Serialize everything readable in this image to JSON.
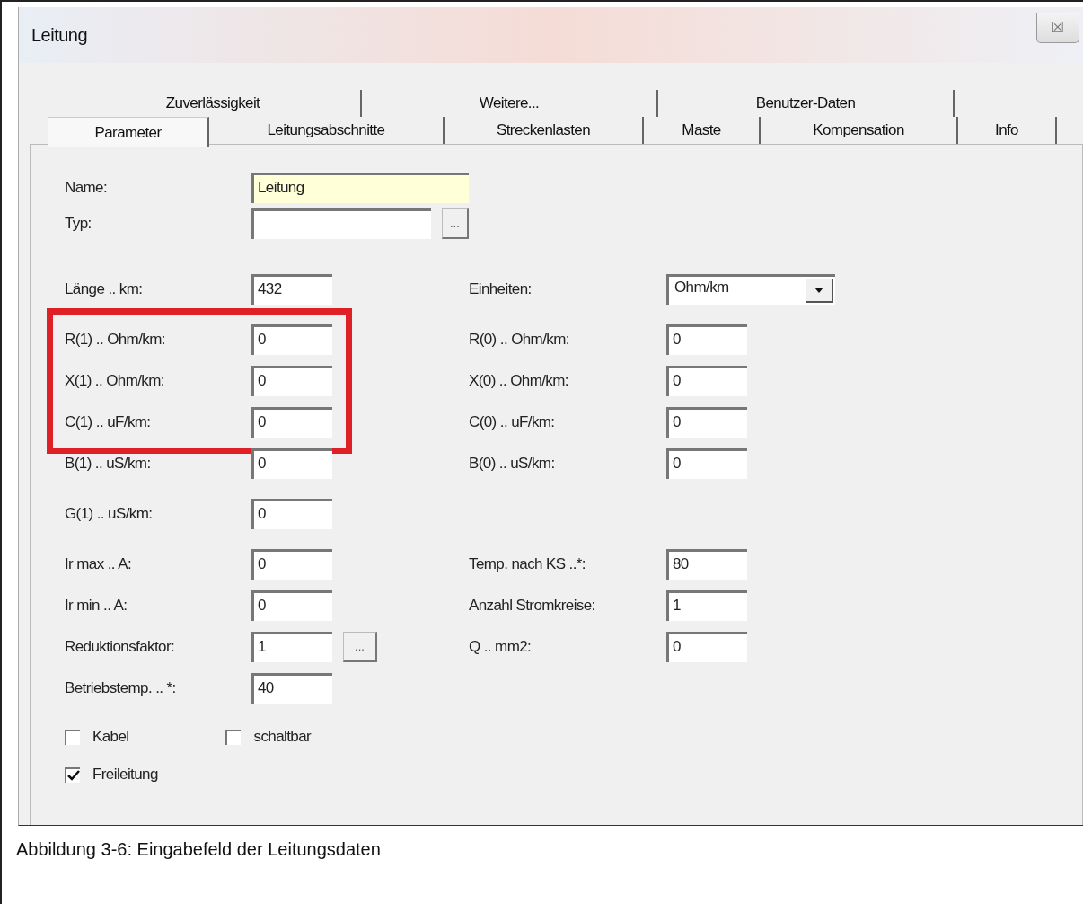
{
  "window": {
    "title": "Leitung",
    "close": "☒"
  },
  "tabs_back_row": [
    {
      "label": "Zuverlässigkeit",
      "selected": false
    },
    {
      "label": "Weitere...",
      "selected": false
    },
    {
      "label": "Benutzer-Daten",
      "selected": false
    }
  ],
  "tabs_front_row": [
    {
      "label": "Parameter",
      "selected": true
    },
    {
      "label": "Leitungsabschnitte",
      "selected": false
    },
    {
      "label": "Streckenlasten",
      "selected": false
    },
    {
      "label": "Maste",
      "selected": false
    },
    {
      "label": "Kompensation",
      "selected": false
    },
    {
      "label": "Info",
      "selected": false
    }
  ],
  "sections": [
    [
      {
        "left": {
          "label": "Name:",
          "value": "Leitung",
          "kind": "wide",
          "focused": true
        }
      },
      {
        "left": {
          "label": "Typ:",
          "kind": "wide",
          "focused": false,
          "browse": "..."
        }
      }
    ],
    [
      {
        "left": {
          "label": "Länge .. km:",
          "value": "432"
        },
        "right": {
          "label": "Einheiten:",
          "value": "Ohm/km",
          "kind": "dropdown"
        }
      }
    ],
    [
      {
        "highlighted": true,
        "left": {
          "label": "R(1) .. Ohm/km:",
          "value": "0"
        },
        "right": {
          "label": "R(0) .. Ohm/km:",
          "value": "0"
        }
      },
      {
        "highlighted": true,
        "left": {
          "label": "X(1) .. Ohm/km:",
          "value": "0"
        },
        "right": {
          "label": "X(0) .. Ohm/km:",
          "value": "0"
        }
      },
      {
        "highlighted": true,
        "left": {
          "label": "C(1) .. uF/km:",
          "value": "0"
        },
        "right": {
          "label": "C(0) .. uF/km:",
          "value": "0"
        }
      },
      {
        "left": {
          "label": "B(1) .. uS/km:",
          "value": "0"
        },
        "right": {
          "label": "B(0) .. uS/km:",
          "value": "0"
        }
      }
    ],
    [
      {
        "left": {
          "label": "G(1) .. uS/km:",
          "value": "0"
        }
      }
    ],
    [
      {
        "left": {
          "label": "Ir max .. A:",
          "value": "0"
        },
        "right": {
          "label": "Temp. nach KS ..*:",
          "value": "80"
        }
      },
      {
        "left": {
          "label": "Ir min .. A:",
          "value": "0"
        },
        "right": {
          "label": "Anzahl Stromkreise:",
          "value": "1"
        }
      },
      {
        "left": {
          "label": "Reduktionsfaktor:",
          "value": "1",
          "browse": "..."
        },
        "right": {
          "label": "Q .. mm2:",
          "value": "0"
        }
      },
      {
        "left": {
          "label": "Betriebstemp. .. *:",
          "value": "40"
        }
      }
    ]
  ],
  "checkboxes": [
    {
      "label": "Kabel",
      "checked": false
    },
    {
      "label": "schaltbar",
      "checked": false
    },
    {
      "label": "Freileitung",
      "checked": true
    }
  ],
  "caption": "Abbildung 3-6: Eingabefeld der Leitungsdaten"
}
